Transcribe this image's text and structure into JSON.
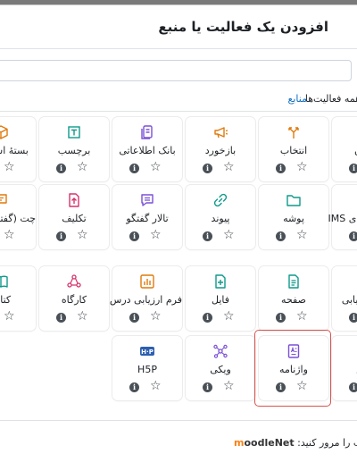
{
  "dialog": {
    "title": "افزودن یک فعالیت یا منبع"
  },
  "search": {
    "placeholder": ""
  },
  "tabs": {
    "all": "همه فعالیت‌ها",
    "resources": "منابع"
  },
  "colors": {
    "accent": "#0f6cbf",
    "highlight": "#d9534f"
  },
  "rows": [
    [
      {
        "label": "بستهٔ اسکورم",
        "icon": "package-icon",
        "color": "#e0790a"
      },
      {
        "label": "برچسب",
        "icon": "label-icon",
        "color": "#0e9a8b"
      },
      {
        "label": "بانک اطلاعاتی",
        "icon": "database-icon",
        "color": "#7b51d6"
      },
      {
        "label": "بازخورد",
        "icon": "megaphone-icon",
        "color": "#e0790a"
      },
      {
        "label": "انتخاب",
        "icon": "choice-icon",
        "color": "#e0790a"
      },
      {
        "label": "آزمون",
        "icon": "quiz-icon",
        "color": "#e0790a"
      }
    ],
    [
      {
        "label": "چت (گفتگوی زنده)",
        "icon": "chat-icon",
        "color": "#e0790a"
      },
      {
        "label": "تکلیف",
        "icon": "assignment-icon",
        "color": "#d6336c"
      },
      {
        "label": "تالار گفتگو",
        "icon": "forum-icon",
        "color": "#7b51d6"
      },
      {
        "label": "پیوند",
        "icon": "link-icon",
        "color": "#0e9a8b"
      },
      {
        "label": "پوشه",
        "icon": "folder-icon",
        "color": "#0e9a8b"
      },
      {
        "label": "بستهٔ محتوای IMS",
        "icon": "ims-icon",
        "color": "#0e9a8b"
      }
    ],
    [
      {
        "label": "کتاب",
        "icon": "book-icon",
        "color": "#0e9a8b"
      },
      {
        "label": "کارگاه",
        "icon": "workshop-icon",
        "color": "#d6336c"
      },
      {
        "label": "فرم ارزیابی درس",
        "icon": "survey-icon",
        "color": "#e0790a"
      },
      {
        "label": "فایل",
        "icon": "file-icon",
        "color": "#0e9a8b"
      },
      {
        "label": "صفحه",
        "icon": "page-icon",
        "color": "#0e9a8b"
      },
      {
        "label": "ابزار ارزیابی",
        "icon": "lti-icon",
        "color": "#d6336c"
      }
    ],
    [
      {
        "label": "H5P",
        "icon": "h5p-icon",
        "color": "#2d5fb1"
      },
      {
        "label": "ویکی",
        "icon": "wiki-icon",
        "color": "#7b51d6"
      },
      {
        "label": "واژنامه",
        "icon": "glossary-icon",
        "color": "#7b51d6"
      },
      {
        "label": "درس",
        "icon": "lesson-icon",
        "color": "#d6336c"
      }
    ]
  ],
  "card_info_glyph": "i",
  "card_star_glyph": "☆",
  "footer": {
    "prefix": "مطالب را مرور کنید:",
    "brand_m": "m",
    "brand_rest": "oodleNet"
  }
}
